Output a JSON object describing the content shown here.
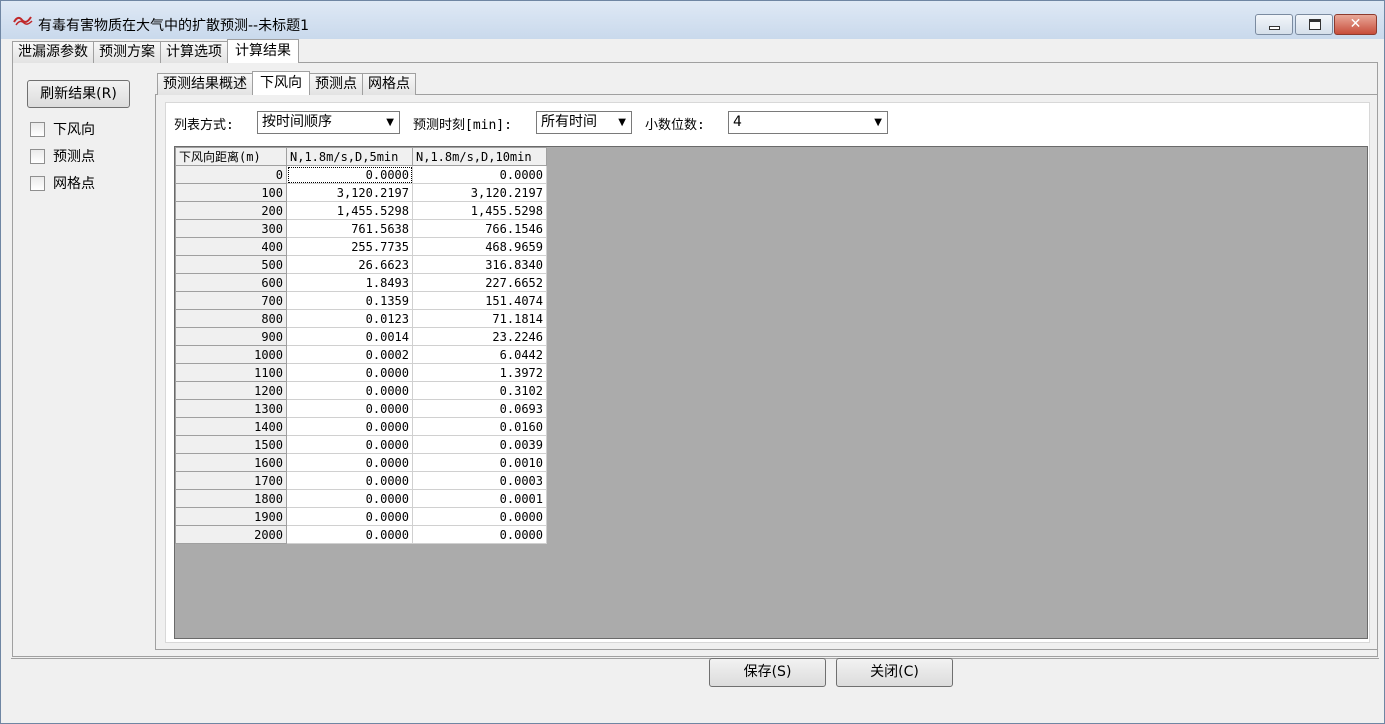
{
  "window": {
    "title": "有毒有害物质在大气中的扩散预测--未标题1",
    "close_glyph": "✕"
  },
  "tabs_top": [
    {
      "label": "泄漏源参数"
    },
    {
      "label": "预测方案"
    },
    {
      "label": "计算选项"
    },
    {
      "label": "计算结果"
    }
  ],
  "left_panel": {
    "refresh_label": "刷新结果(R)",
    "checkboxes": [
      {
        "label": "下风向",
        "checked": false
      },
      {
        "label": "预测点",
        "checked": false
      },
      {
        "label": "网格点",
        "checked": false
      }
    ]
  },
  "tabs_inner": [
    {
      "label": "预测结果概述"
    },
    {
      "label": "下风向"
    },
    {
      "label": "预测点"
    },
    {
      "label": "网格点"
    }
  ],
  "options": {
    "list_mode_label": "列表方式:",
    "list_mode_value": "按时间顺序",
    "time_label": "预测时刻[min]:",
    "time_value": "所有时间",
    "decimals_label": "小数位数:",
    "decimals_value": "4"
  },
  "grid": {
    "headers": [
      "下风向距离(m)",
      "N,1.8m/s,D,5min",
      "N,1.8m/s,D,10min"
    ],
    "rows": [
      [
        "0",
        "0.0000",
        "0.0000"
      ],
      [
        "100",
        "3,120.2197",
        "3,120.2197"
      ],
      [
        "200",
        "1,455.5298",
        "1,455.5298"
      ],
      [
        "300",
        "761.5638",
        "766.1546"
      ],
      [
        "400",
        "255.7735",
        "468.9659"
      ],
      [
        "500",
        "26.6623",
        "316.8340"
      ],
      [
        "600",
        "1.8493",
        "227.6652"
      ],
      [
        "700",
        "0.1359",
        "151.4074"
      ],
      [
        "800",
        "0.0123",
        "71.1814"
      ],
      [
        "900",
        "0.0014",
        "23.2246"
      ],
      [
        "1000",
        "0.0002",
        "6.0442"
      ],
      [
        "1100",
        "0.0000",
        "1.3972"
      ],
      [
        "1200",
        "0.0000",
        "0.3102"
      ],
      [
        "1300",
        "0.0000",
        "0.0693"
      ],
      [
        "1400",
        "0.0000",
        "0.0160"
      ],
      [
        "1500",
        "0.0000",
        "0.0039"
      ],
      [
        "1600",
        "0.0000",
        "0.0010"
      ],
      [
        "1700",
        "0.0000",
        "0.0003"
      ],
      [
        "1800",
        "0.0000",
        "0.0001"
      ],
      [
        "1900",
        "0.0000",
        "0.0000"
      ],
      [
        "2000",
        "0.0000",
        "0.0000"
      ]
    ]
  },
  "buttons": {
    "save_label": "保存(S)",
    "close_label": "关闭(C)"
  }
}
